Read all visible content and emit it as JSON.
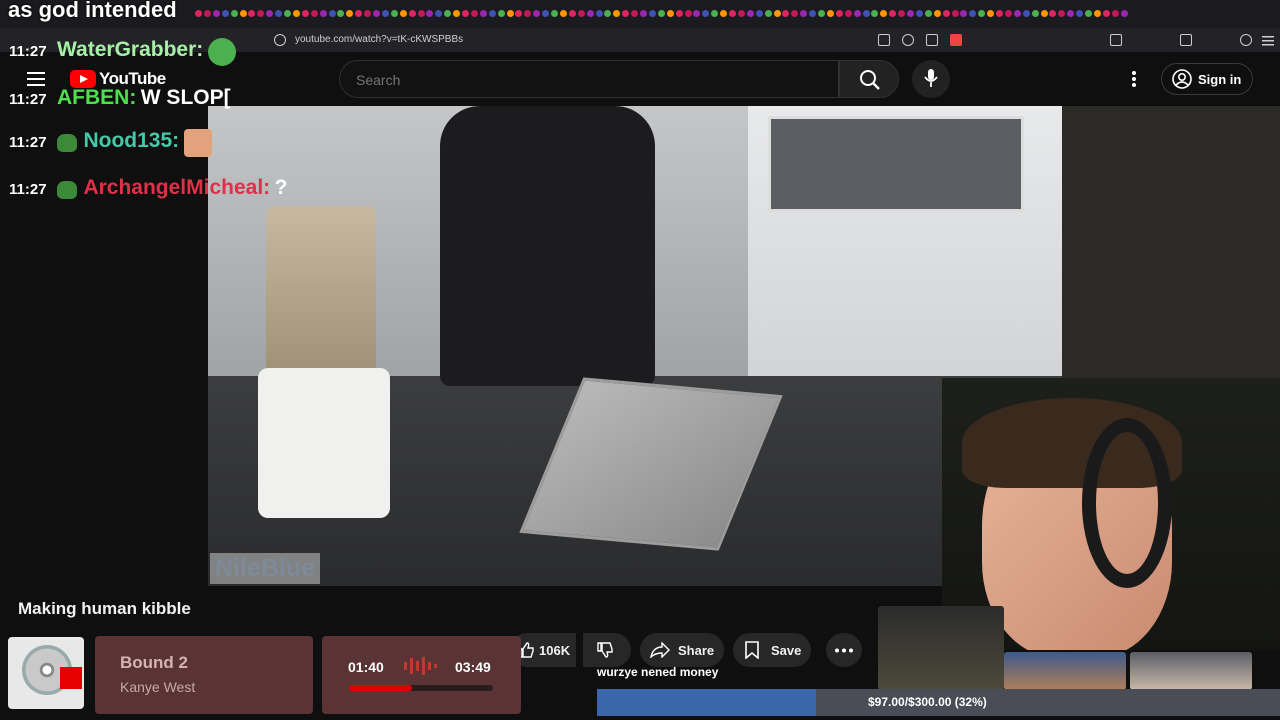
{
  "overlay": {
    "title": "as god intended"
  },
  "browser": {
    "url": "youtube.com/watch?v=tK-cKWSPBBs"
  },
  "youtube": {
    "logo": "YouTube",
    "search_placeholder": "Search",
    "sign_in": "Sign in",
    "video_title": "Making human kibble",
    "watermark": "NileBlue",
    "likes": "106K",
    "share": "Share",
    "save": "Save"
  },
  "chat": [
    {
      "time": "11:27",
      "user": "WaterGrabber:",
      "message": "",
      "color": "#a8f0a8"
    },
    {
      "time": "11:27",
      "user": "AFBEN:",
      "message": "W SLOP[",
      "color": "#4ee04e"
    },
    {
      "time": "11:27",
      "user": "Nood135:",
      "message": "",
      "color": "#44c8a8"
    },
    {
      "time": "11:27",
      "user": "ArchangelMicheal:",
      "message": "?",
      "color": "#e03048"
    }
  ],
  "now_playing": {
    "song": "Bound 2",
    "artist": "Kanye West",
    "elapsed": "01:40",
    "total": "03:49",
    "progress": 0.44
  },
  "donation_goal": {
    "label": "wurzye nened money",
    "text": "$97.00/$300.00 (32%)",
    "progress": 0.32
  },
  "colors": {
    "accent_red": "#e00000",
    "goal_fill": "#3b67a8",
    "link_blue": "#3ea6ff"
  }
}
